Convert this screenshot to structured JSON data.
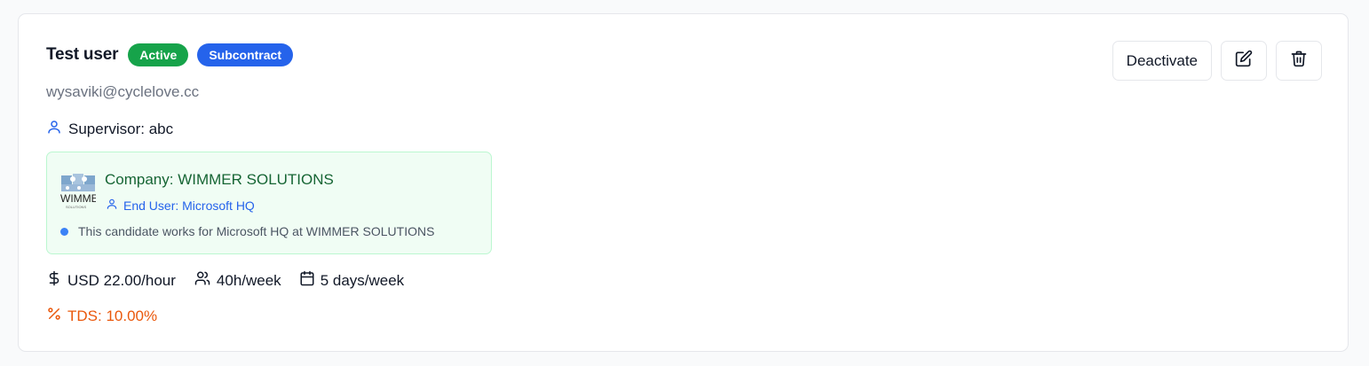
{
  "user": {
    "name": "Test user",
    "email": "wysaviki@cyclelove.cc",
    "badges": {
      "status": "Active",
      "type": "Subcontract"
    },
    "supervisor": "Supervisor: abc"
  },
  "company": {
    "name": "Company: WIMMER SOLUTIONS",
    "end_user": "End User: Microsoft HQ",
    "note": "This candidate works for Microsoft HQ at WIMMER SOLUTIONS",
    "logo_text": "WIMME",
    "logo_subtext": "SOLUTIONS"
  },
  "stats": {
    "rate": "USD 22.00/hour",
    "hours": "40h/week",
    "days": "5 days/week"
  },
  "tds": "TDS: 10.00%",
  "actions": {
    "deactivate_label": "Deactivate",
    "edit_icon": "edit-icon",
    "delete_icon": "trash-icon"
  },
  "colors": {
    "active_badge": "#16a34a",
    "subcontract_badge": "#2563eb",
    "company_bg": "#f0fdf4",
    "company_text": "#166534",
    "end_user_text": "#2563eb",
    "tds_text": "#ea580c"
  }
}
